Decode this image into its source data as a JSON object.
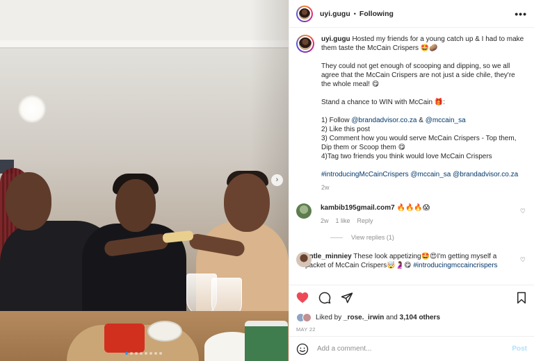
{
  "header": {
    "username": "uyi.gugu",
    "separator": "•",
    "follow_status": "Following",
    "more_icon": "more-horizontal-icon"
  },
  "photo": {
    "next_icon": "chevron-right-icon",
    "carousel_count": 8,
    "carousel_active": 1
  },
  "caption": {
    "username": "uyi.gugu",
    "line1": " Hosted my friends for a young catch up & I had to make them taste the McCain Crispers 🤩🥔",
    "para2": "They could not get enough of scooping and dipping, so we all agree that the McCain Crispers are not just a side chile, they're the whole meal! 😋",
    "para3": "Stand a chance to WIN with McCain 🎁:",
    "rule1_prefix": "1) Follow ",
    "rule1_tag1": "@brandadvisor.co.za",
    "rule1_mid": " & ",
    "rule1_tag2": "@mccain_sa",
    "rule2": "2) Like this post",
    "rule3": "3) Comment how you would serve McCain Crispers - Top them, Dip them or Scoop them 😋",
    "rule4": "4)Tag two friends you think would love McCain Crispers",
    "hashtags": "#introducingMcCainCrispers @mccain_sa @brandadvisor.co.za",
    "time": "2w"
  },
  "comments": [
    {
      "username": "kambib195gmail.com7",
      "text": " 🔥🔥🔥😱",
      "time": "2w",
      "likes": "1 like",
      "reply": "Reply",
      "view_replies": "View replies (1)"
    },
    {
      "username": "entle_minniey",
      "text": " These look appetizing🤩😍I'm getting myself a packet of McCain Crispers🤯🤰😋 ",
      "tag": "#introducingmccaincrispers"
    }
  ],
  "likes": {
    "prefix": "Liked by ",
    "user": "_rose._irwin",
    "middle": " and ",
    "count": "3,104 others"
  },
  "date": "MAY 22",
  "comment_box": {
    "placeholder": "Add a comment...",
    "post_label": "Post"
  },
  "colors": {
    "like_red": "#ed4956",
    "link_blue": "#00376b",
    "post_blue": "#b2dffc",
    "carousel_active": "#3897f0"
  }
}
